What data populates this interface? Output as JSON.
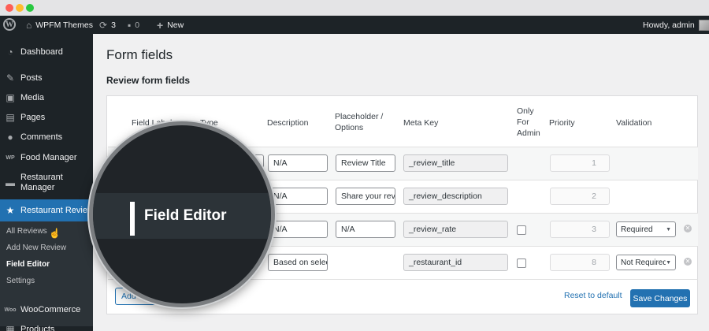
{
  "admin_bar": {
    "site_name": "WPFM Themes",
    "updates_count": "3",
    "comments_count": "0",
    "new_label": "New",
    "greeting": "Howdy, admin"
  },
  "sidebar": {
    "items": [
      {
        "label": "Dashboard",
        "icon": "dashboard-icon"
      },
      {
        "label": "Posts",
        "icon": "pin-icon"
      },
      {
        "label": "Media",
        "icon": "media-icon"
      },
      {
        "label": "Pages",
        "icon": "pages-icon"
      },
      {
        "label": "Comments",
        "icon": "comments-icon"
      },
      {
        "label": "Food Manager",
        "icon": "food-manager-icon"
      },
      {
        "label": "Restaurant",
        "label2": "Manager",
        "icon": "restaurant-manager-icon"
      },
      {
        "label": "Restaurant Review",
        "icon": "star-icon"
      },
      {
        "label": "WooCommerce",
        "icon": "woocommerce-icon"
      },
      {
        "label": "Products",
        "icon": "products-icon"
      }
    ],
    "submenu": [
      "All Reviews",
      "Add New Review",
      "Field Editor",
      "Settings"
    ]
  },
  "page": {
    "title": "Form fields",
    "section_title": "Review form fields"
  },
  "table": {
    "headers": {
      "field_label": "Field Label",
      "type": "Type",
      "description": "Description",
      "placeholder_1": "Placeholder /",
      "placeholder_2": "Options",
      "meta_key": "Meta Key",
      "only_1": "Only",
      "only_2": "For",
      "only_3": "Admin",
      "priority": "Priority",
      "validation": "Validation"
    },
    "rows": [
      {
        "description": "N/A",
        "placeholder": "Review Title",
        "meta_key": "_review_title",
        "priority": "1",
        "validation": ""
      },
      {
        "description": "N/A",
        "placeholder": "Share your review",
        "meta_key": "_review_description",
        "priority": "2",
        "validation": ""
      },
      {
        "description": "N/A",
        "placeholder": "N/A",
        "meta_key": "_review_rate",
        "priority": "3",
        "validation": "Required"
      },
      {
        "description": "Based on selection",
        "placeholder": "",
        "meta_key": "_restaurant_id",
        "priority": "8",
        "validation": "Not Required"
      }
    ],
    "add_button": "Add field",
    "reset_link": "Reset to default",
    "save_button": "Save Changes"
  },
  "magnifier": {
    "label": "Field Editor"
  },
  "colors": {
    "admin_dark": "#1d2327",
    "accent_blue": "#2271b1",
    "submenu_bg": "#2c3338"
  }
}
